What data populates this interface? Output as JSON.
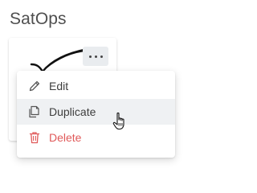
{
  "header": {
    "title": "SatOps"
  },
  "card": {
    "logo": "signature-checkmark-logo",
    "more_button": "more-options-icon"
  },
  "context_menu": {
    "items": [
      {
        "label": "Edit",
        "icon": "pencil-icon",
        "state": "default"
      },
      {
        "label": "Duplicate",
        "icon": "copy-icon",
        "state": "hover"
      },
      {
        "label": "Delete",
        "icon": "trash-icon",
        "state": "danger"
      }
    ]
  },
  "colors": {
    "title_text": "#4f4f4f",
    "menu_text": "#3d3d3d",
    "danger": "#e05a5a",
    "hover_bg": "#eff1f3",
    "more_button_bg": "#e9ecef"
  },
  "cursor": "hand-pointer-cursor"
}
